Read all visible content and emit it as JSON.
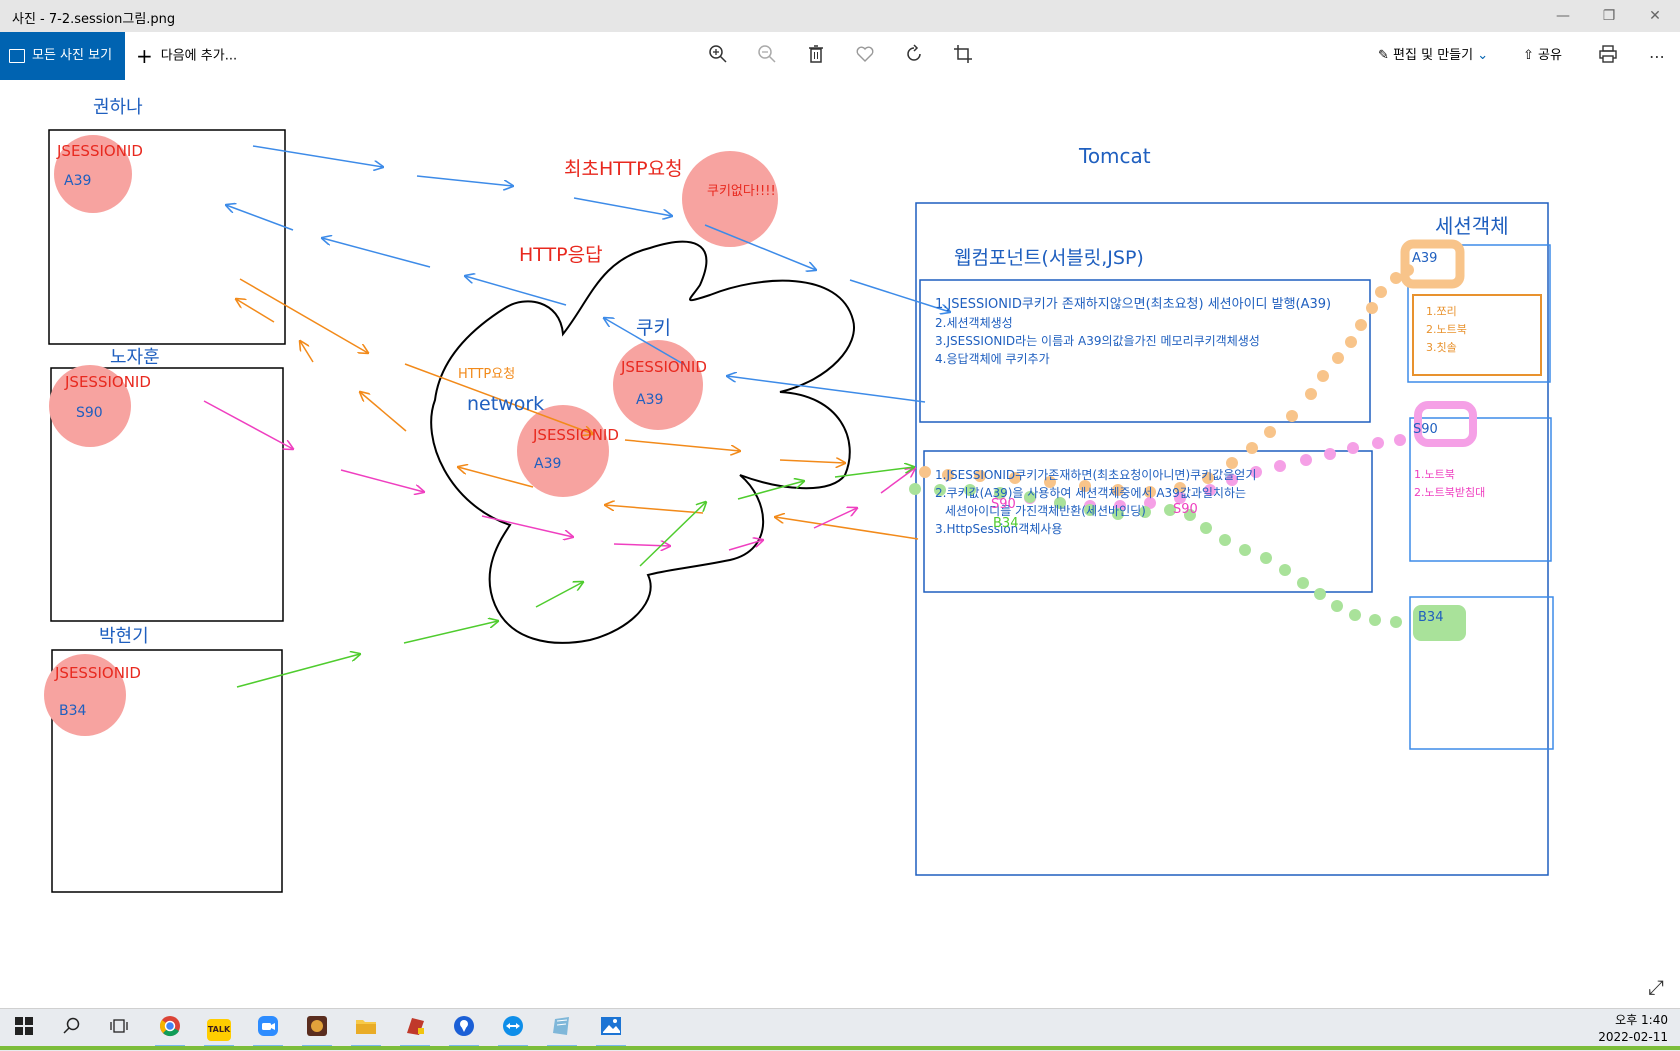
{
  "window": {
    "title": "사진 - 7-2.session그림.png",
    "controls": [
      "minimize",
      "maximize",
      "close"
    ]
  },
  "toolbar": {
    "all_photos_label": "모든 사진 보기",
    "add_to_label": "다음에 추가...",
    "icons": [
      "zoom-in-icon",
      "zoom-out-icon",
      "delete-icon",
      "favorite-icon",
      "rotate-icon",
      "crop-icon"
    ],
    "edit_create_label": "편집 및 만들기",
    "share_label": "공유",
    "print_label": "print",
    "more_label": "⋯"
  },
  "drawing": {
    "clients": [
      {
        "name": "권하나",
        "cookie_label": "JSESSIONID",
        "session_id": "A39"
      },
      {
        "name": "노자훈",
        "cookie_label": "JSESSIONID",
        "session_id": "S90"
      },
      {
        "name": "박현기",
        "cookie_label": "JSESSIONID",
        "session_id": "B34"
      }
    ],
    "first_request_label": "최초HTTP요청",
    "no_cookie_label": "쿠키없다!!!!",
    "http_response_label": "HTTP응답",
    "cookie_label": "쿠키",
    "http_request_label": "HTTP요청",
    "network_label": "network",
    "network_cookie": {
      "label": "JSESSIONID",
      "value": "A39"
    },
    "network_cookie2": {
      "label": "JSESSIONID",
      "value": "A39"
    },
    "tomcat_label": "Tomcat",
    "web_component_label": "웹컴포넌트(서블릿,JSP)",
    "session_object_label": "세션객체",
    "step_box_1": [
      "1.JSESSIONID쿠키가 존재하지않으면(최초요청) 세션아이디 발행(A39)",
      "2.세션객체생성",
      "3.JSESSIONID라는 이름과 A39의값을가진 메모리쿠키객체생성",
      "4.응답객체에 쿠키추가"
    ],
    "step_box_2": [
      "1.JSESSIONID쿠키가존재하면(최초요청이아니면)쿠키값을얻기",
      "2.쿠키값(A39)을 사용하여 세션객체중에서 A39값과일치하는",
      "세션아이디를 가진객체반환(세션바인딩)",
      "3.HttpSession객체사용"
    ],
    "overlay_labels": [
      "S90",
      "B34",
      "S90"
    ],
    "sessions": [
      {
        "id": "A39",
        "items": [
          "1.쪼리",
          "2.노트북",
          "3.칫솔"
        ],
        "color": "#e8922e"
      },
      {
        "id": "S90",
        "items": [
          "1.노트북",
          "2.노트북받침대"
        ],
        "color": "#e83fc4"
      },
      {
        "id": "B34",
        "items": [],
        "color": "#55c23a"
      }
    ],
    "colors": {
      "blue_text": "#1f5fbf",
      "red_text": "#e8291f",
      "orange": "#f28a1a",
      "pink": "#ef3fc0",
      "green": "#4fcc2e",
      "circle": "#f7a3a0"
    }
  },
  "taskbar": {
    "apps": [
      "start-icon",
      "search-icon",
      "task-view-icon",
      "chrome-icon",
      "kakaotalk-icon",
      "zoom-icon",
      "game-icon",
      "file-explorer-icon",
      "app-icon",
      "maps-icon",
      "teamviewer-icon",
      "notepad-icon",
      "photos-icon"
    ],
    "kakao_label": "TALK",
    "time": "오후 1:40",
    "date": "2022-02-11"
  }
}
